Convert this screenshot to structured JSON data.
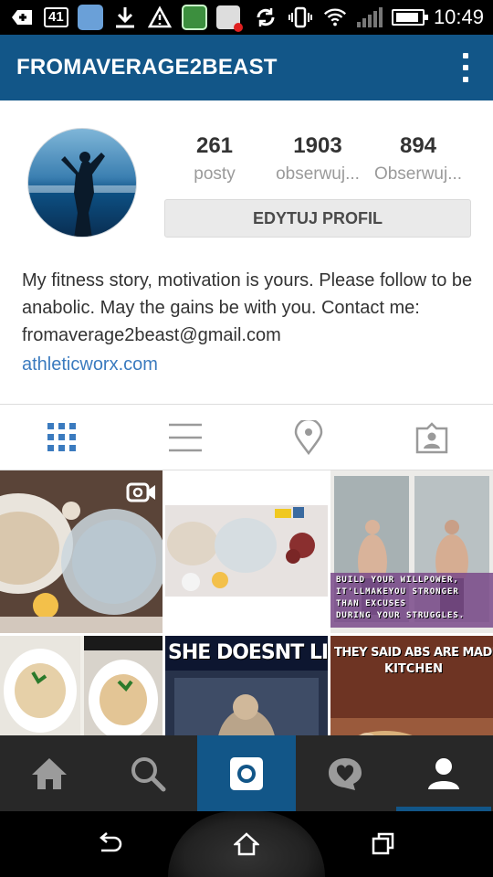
{
  "status_bar": {
    "notification_count": "41",
    "time": "10:49",
    "icons": [
      "add-icon",
      "notification-count-icon",
      "app-icon",
      "download-icon",
      "warning-icon",
      "app-icon",
      "app-icon",
      "sync-icon",
      "vibrate-icon",
      "wifi-icon",
      "signal-icon",
      "battery-icon"
    ]
  },
  "app_bar": {
    "title": "FROMAVERAGE2BEAST",
    "menu_icon": "more-vert-icon"
  },
  "profile": {
    "stats": [
      {
        "value": "261",
        "label": "posty"
      },
      {
        "value": "1903",
        "label": "obserwuj..."
      },
      {
        "value": "894",
        "label": "Obserwuj..."
      }
    ],
    "edit_button": "EDYTUJ PROFIL",
    "bio": "My fitness story, motivation is yours. Please follow to be anabolic. May the gains be with you. Contact me: fromaverage2beast@gmail.com",
    "link": "athleticworx.com"
  },
  "view_tabs": [
    {
      "icon": "grid-icon",
      "active": true
    },
    {
      "icon": "list-icon",
      "active": false
    },
    {
      "icon": "location-pin-icon",
      "active": false
    },
    {
      "icon": "tagged-person-icon",
      "active": false
    }
  ],
  "posts": [
    {
      "kind": "video",
      "icon": "video-camera-icon"
    },
    {
      "kind": "photo"
    },
    {
      "kind": "photo",
      "caption_lines": [
        "BUILD YOUR WILLPOWER,",
        "IT'LLMAKEYOU STRONGER",
        "THAN EXCUSES",
        "DURING YOUR STRUGGLES."
      ]
    },
    {
      "kind": "photo"
    },
    {
      "kind": "photo",
      "caption": "SHE DOESNT LIFT"
    },
    {
      "kind": "photo",
      "caption_lines": [
        "THEY SAID ABS ARE MADE IN THE",
        "KITCHEN"
      ]
    }
  ],
  "bottom_nav": [
    {
      "icon": "home-icon",
      "active": false
    },
    {
      "icon": "search-icon",
      "active": false
    },
    {
      "icon": "camera-icon",
      "active": false,
      "highlight": true
    },
    {
      "icon": "activity-heart-icon",
      "active": false
    },
    {
      "icon": "profile-icon",
      "active": true
    }
  ],
  "system_nav": [
    "back-icon",
    "home-icon",
    "recents-icon"
  ],
  "colors": {
    "brand_blue": "#125688",
    "link_blue": "#3b7bbf",
    "tab_active": "#3b7bbf",
    "tab_inactive": "#9a9a9a"
  }
}
